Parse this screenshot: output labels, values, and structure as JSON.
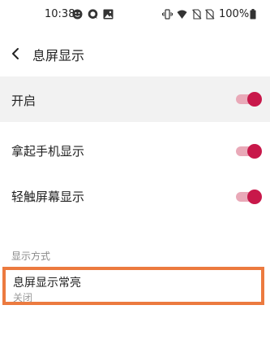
{
  "status_bar": {
    "time": "10:38",
    "battery": "100%"
  },
  "header": {
    "title": "息屏显示"
  },
  "master_switch": {
    "label": "开启",
    "on": true
  },
  "settings": [
    {
      "label": "拿起手机显示",
      "on": true
    },
    {
      "label": "轻触屏幕显示",
      "on": true
    }
  ],
  "display_section": {
    "header": "显示方式"
  },
  "always_on": {
    "title": "息屏显示常亮",
    "value": "关闭"
  },
  "colors": {
    "accent": "#c8184a",
    "track": "#e9a9b8",
    "highlight_border": "#ec7a3f"
  }
}
